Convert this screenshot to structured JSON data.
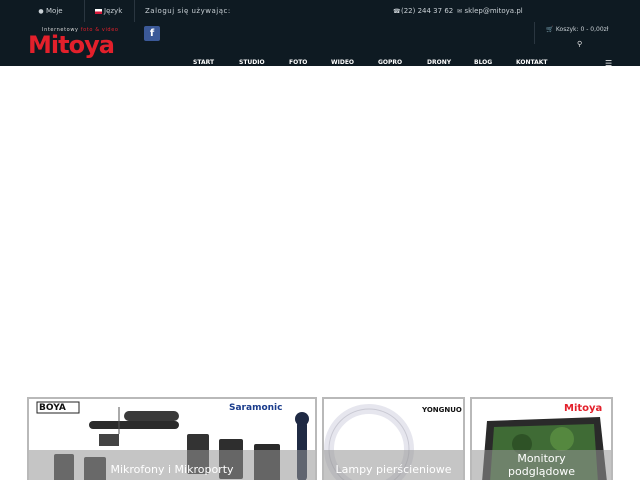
{
  "topbar": {
    "account_label": "Moje",
    "language_label": "Język",
    "login_text": "Zaloguj się używając:",
    "phone": "(22) 244 37 62",
    "email": "sklep@mitoya.pl"
  },
  "header": {
    "logo_text": "Mitoya",
    "logo_tagline_prefix": "Internetowy",
    "logo_tagline": "foto & video",
    "cart_label": "Koszyk:",
    "cart_value": "0 - 0,00zł"
  },
  "nav": {
    "items": [
      "START",
      "STUDIO",
      "FOTO",
      "WIDEO",
      "GOPRO",
      "DRONY",
      "BLOG",
      "KONTAKT"
    ]
  },
  "tiles": [
    {
      "caption": "Mikrofony i Mikroporty",
      "brand_left": "BOYA",
      "brand_right": "Saramonic"
    },
    {
      "caption": "Lampy pierścieniowe",
      "brand_right": "YONGNUO"
    },
    {
      "caption_line1": "Monitory",
      "caption_line2": "podglądowe",
      "brand_right": "Mitoya"
    }
  ],
  "colors": {
    "topbar_bg": "#0e1a22",
    "brand_red": "#e3202b",
    "facebook_blue": "#3b5998"
  }
}
